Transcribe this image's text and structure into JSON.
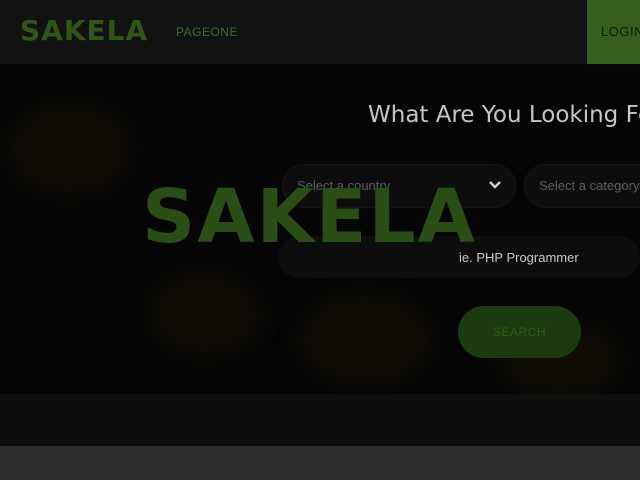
{
  "navbar": {
    "logo": "SAKELA",
    "links": [
      "PAGEONE"
    ],
    "login_label": "LOGIN"
  },
  "hero": {
    "title": "What Are You Looking For?",
    "country_select": {
      "placeholder": "Select a country",
      "icon": "chevron-down-icon"
    },
    "category_select": {
      "placeholder": "Select a category"
    },
    "keyword_input": {
      "placeholder": "ie. PHP Programmer",
      "value": ""
    },
    "search_label": "SEARCH",
    "watermark": "SAKELA"
  },
  "colors": {
    "brand_green": "#2f5619",
    "button_green": "#1b3a10",
    "login_green": "#355d1d",
    "background": "#0a0a0a"
  }
}
